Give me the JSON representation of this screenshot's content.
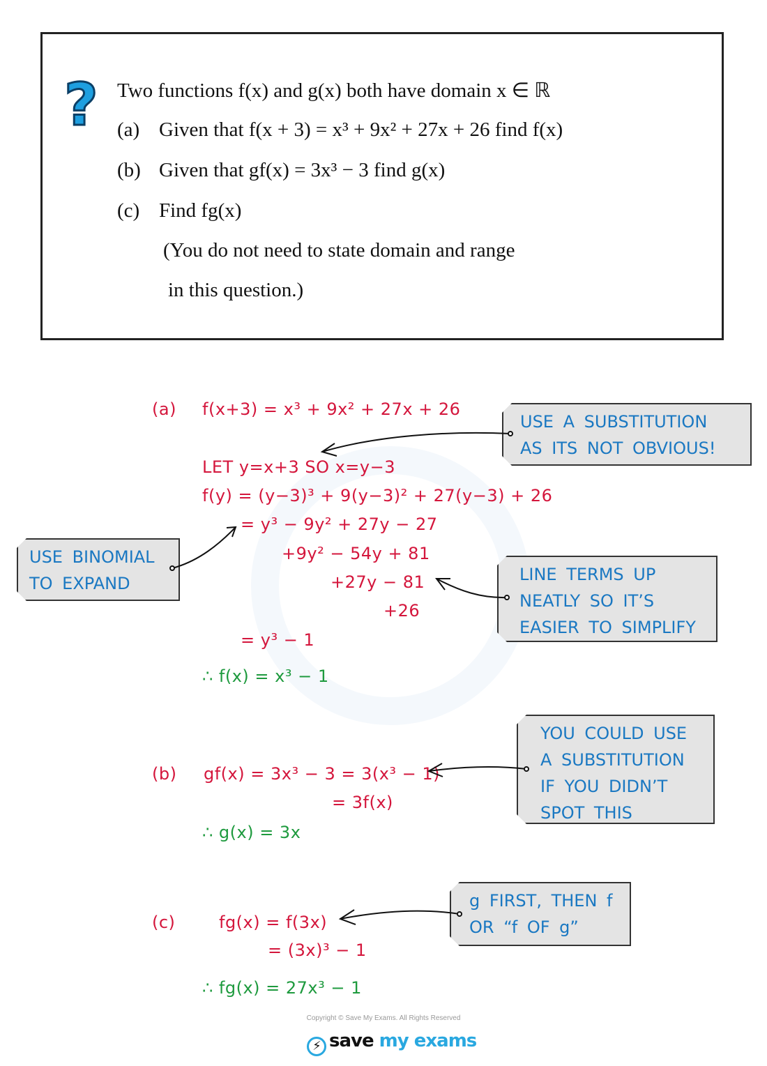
{
  "question": {
    "icon": "question-mark-icon",
    "intro": "Two functions f(x) and g(x) both have domain x ∈ ℝ",
    "parts": [
      {
        "label": "(a)",
        "text": "Given that f(x + 3) = x³ + 9x² + 27x + 26 find f(x)"
      },
      {
        "label": "(b)",
        "text": "Given that gf(x) = 3x³ − 3 find g(x)"
      },
      {
        "label": "(c)",
        "text": "Find fg(x)"
      }
    ],
    "note_line1": "(You do not need to state domain and range",
    "note_line2": "in this question.)"
  },
  "solution": {
    "a": {
      "label": "(a)",
      "lines": [
        "f(x+3) = x³ + 9x² + 27x + 26",
        "LET  y=x+3   SO  x=y−3",
        "f(y) = (y−3)³ + 9(y−3)² + 27(y−3) + 26",
        "= y³ − 9y² + 27y − 27",
        "+9y² − 54y + 81",
        "+27y − 81",
        "+26",
        "= y³ − 1"
      ],
      "answer": "∴  f(x) = x³ − 1"
    },
    "b": {
      "label": "(b)",
      "lines": [
        "gf(x) = 3x³ − 3 = 3(x³ − 1)",
        "= 3f(x)"
      ],
      "answer": "∴  g(x) = 3x"
    },
    "c": {
      "label": "(c)",
      "lines": [
        "fg(x) = f(3x)",
        "= (3x)³ − 1"
      ],
      "answer": "∴  fg(x) = 27x³ − 1"
    }
  },
  "notes": {
    "substitution": [
      "USE  A  SUBSTITUTION",
      "AS  ITS  NOT  OBVIOUS!"
    ],
    "binomial": [
      "USE  BINOMIAL",
      "TO  EXPAND"
    ],
    "line_terms": [
      "LINE  TERMS  UP",
      "NEATLY  SO  IT’S",
      "EASIER  TO  SIMPLIFY"
    ],
    "could_use": [
      "YOU  COULD  USE",
      "A  SUBSTITUTION",
      "IF  YOU  DIDN’T",
      "SPOT  THIS"
    ],
    "g_first": [
      "g  FIRST,  THEN  f",
      "OR  “f  OF  g”"
    ]
  },
  "footer": {
    "copyright": "Copyright © Save My Exams. All Rights Reserved",
    "logo_part1": "save",
    "logo_part2": "my exams"
  }
}
